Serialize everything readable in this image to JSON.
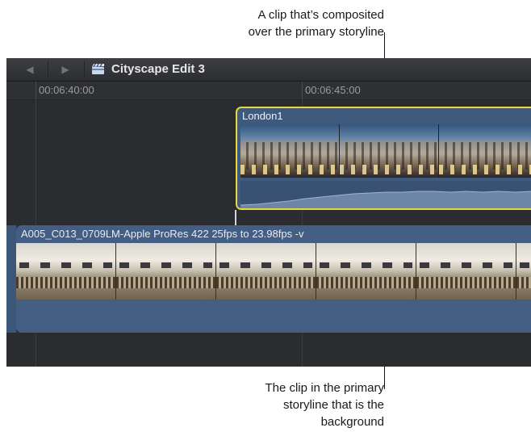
{
  "annotations": {
    "top": [
      "A clip that’s composited",
      "over the primary storyline"
    ],
    "bottom": [
      "The clip in the primary",
      "storyline that is the",
      "background"
    ]
  },
  "window": {
    "back_icon": "◀",
    "forward_icon": "▶",
    "project_icon": "clapperboard-icon",
    "project_title": "Cityscape Edit 3"
  },
  "ruler": {
    "timecodes": [
      "00:06:40:00",
      "00:06:45:00"
    ]
  },
  "connected_clip": {
    "name": "London1",
    "border_color": "#e8d83c"
  },
  "primary_clip": {
    "name": "A005_C013_0709LM-Apple ProRes 422 25fps to 23.98fps -v"
  },
  "colors": {
    "timeline_bg": "#2b2c2f",
    "clip_blue": "#435e82",
    "selection_yellow": "#e8d83c"
  }
}
